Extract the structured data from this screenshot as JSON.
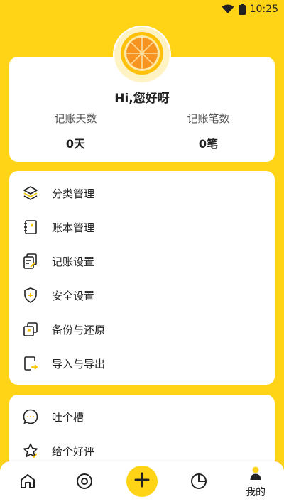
{
  "status_bar": {
    "time": "10:25",
    "wifi_icon": "wifi-icon",
    "battery_icon": "battery-icon"
  },
  "profile": {
    "avatar_icon": "orange-slice-icon",
    "greeting": "Hi,您好呀",
    "stats": [
      {
        "label": "记账天数",
        "value": "0天"
      },
      {
        "label": "记账笔数",
        "value": "0笔"
      }
    ]
  },
  "menu": {
    "items": [
      {
        "label": "分类管理",
        "icon": "layers-icon"
      },
      {
        "label": "账本管理",
        "icon": "notebook-icon"
      },
      {
        "label": "记账设置",
        "icon": "edit-settings-icon"
      },
      {
        "label": "安全设置",
        "icon": "shield-icon"
      },
      {
        "label": "备份与还原",
        "icon": "backup-icon"
      },
      {
        "label": "导入与导出",
        "icon": "import-export-icon"
      }
    ]
  },
  "menu2": {
    "items": [
      {
        "label": "吐个槽",
        "icon": "chat-bubble-icon"
      },
      {
        "label": "给个好评",
        "icon": "star-icon"
      }
    ]
  },
  "bottom_nav": {
    "items": [
      {
        "name": "home",
        "icon": "home-icon"
      },
      {
        "name": "discover",
        "icon": "target-icon"
      },
      {
        "name": "add",
        "icon": "plus-icon"
      },
      {
        "name": "stats",
        "icon": "pie-chart-icon"
      },
      {
        "name": "mine",
        "icon": "user-icon",
        "label": "我的"
      }
    ]
  },
  "colors": {
    "accent": "#FFD416",
    "text": "#222222",
    "muted": "#555555"
  }
}
